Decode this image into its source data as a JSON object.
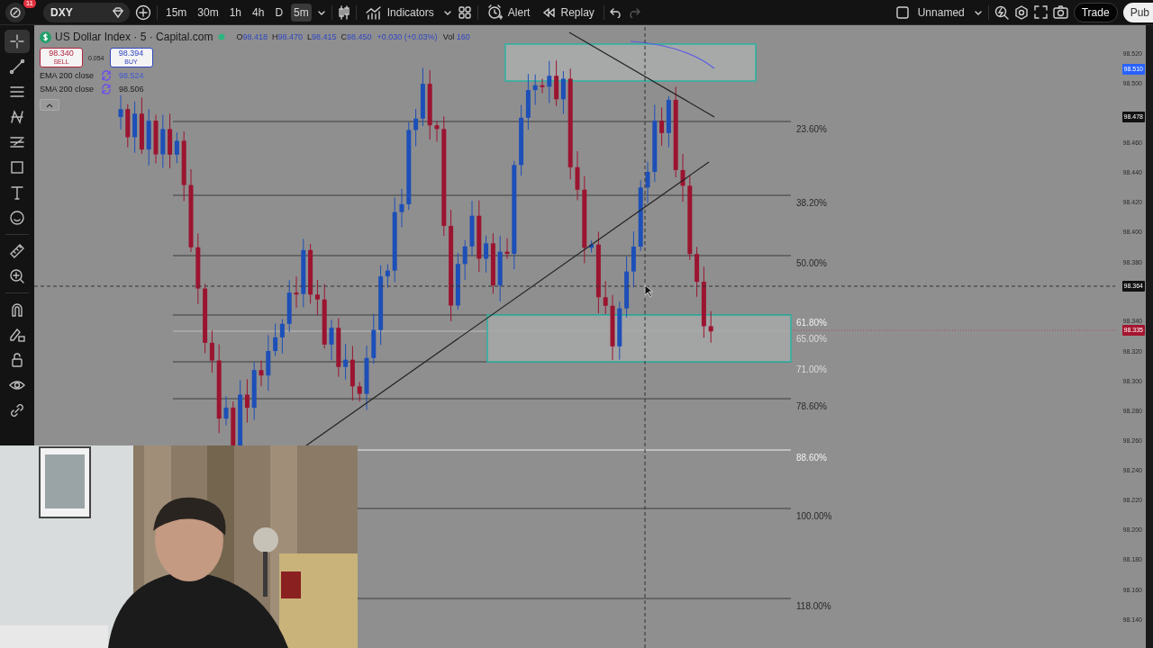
{
  "toolbar": {
    "notifications": "11",
    "symbol": "DXY",
    "intervals": [
      {
        "label": "15m",
        "selected": false
      },
      {
        "label": "30m",
        "selected": false
      },
      {
        "label": "1h",
        "selected": false
      },
      {
        "label": "4h",
        "selected": false
      },
      {
        "label": "D",
        "selected": false
      },
      {
        "label": "5m",
        "selected": true
      }
    ],
    "indicators": "Indicators",
    "alert": "Alert",
    "replay": "Replay",
    "layout_name": "Unnamed",
    "trade": "Trade",
    "publish": "Pub"
  },
  "drawing_tools": [
    {
      "kind": "crosshair",
      "selected": true
    },
    {
      "kind": "trendline",
      "selected": false
    },
    {
      "kind": "parallel",
      "selected": false
    },
    {
      "kind": "pattern",
      "selected": false
    },
    {
      "kind": "fib",
      "selected": false
    },
    {
      "kind": "rectangle",
      "selected": false
    },
    {
      "kind": "text",
      "selected": false
    },
    {
      "kind": "emoji",
      "selected": false
    },
    {
      "kind": "ruler",
      "selected": false
    },
    {
      "kind": "zoom",
      "selected": false
    },
    {
      "kind": "magnet",
      "selected": false
    },
    {
      "kind": "lockpen",
      "selected": false
    },
    {
      "kind": "lock",
      "selected": false
    },
    {
      "kind": "eye",
      "selected": false
    },
    {
      "kind": "link",
      "selected": false
    }
  ],
  "legend": {
    "title": "US Dollar Index · 5 · Capital.com",
    "ohlc": [
      {
        "key": "O",
        "value": "98.418"
      },
      {
        "key": "H",
        "value": "98.470"
      },
      {
        "key": "L",
        "value": "98.415"
      },
      {
        "key": "C",
        "value": "98.450"
      }
    ],
    "change": "+0.030 (+0.03%)",
    "volume_label": "Vol",
    "volume": "160",
    "sell": {
      "price": "98.340",
      "label": "SELL"
    },
    "spread": "0.054",
    "buy": {
      "price": "98.394",
      "label": "BUY"
    },
    "indicators": [
      {
        "name": "EMA 200 close",
        "value": "98.524",
        "color": "#4358d6"
      },
      {
        "name": "SMA 200 close",
        "value": "98.506",
        "color": "#222222"
      }
    ]
  },
  "fib_levels": [
    {
      "label": "23.60%",
      "color": "#2a2a2a"
    },
    {
      "label": "38.20%",
      "color": "#2a2a2a"
    },
    {
      "label": "50.00%",
      "color": "#2a2a2a"
    },
    {
      "label": "61.80%",
      "color": "#f2f2f2"
    },
    {
      "label": "65.00%",
      "color": "#dcdcdc"
    },
    {
      "label": "71.00%",
      "color": "#dcdcdc"
    },
    {
      "label": "78.60%",
      "color": "#2a2a2a"
    },
    {
      "label": "88.60%",
      "color": "#f2f2f2"
    },
    {
      "label": "100.00%",
      "color": "#2a2a2a"
    },
    {
      "label": "118.00%",
      "color": "#2a2a2a"
    }
  ],
  "price_axis": {
    "ticks": [
      "98.520",
      "98.500",
      "98.460",
      "98.440",
      "98.420",
      "98.400",
      "98.380",
      "98.340",
      "98.320",
      "98.300",
      "98.280",
      "98.260",
      "98.240",
      "98.220",
      "98.200",
      "98.180",
      "98.160",
      "98.140"
    ],
    "tags": [
      {
        "price": "98.510",
        "color": "#2962ff"
      },
      {
        "price": "98.478",
        "color": "#111111"
      },
      {
        "price": "98.364",
        "color": "#111111"
      },
      {
        "price": "98.335",
        "color": "#a5152f"
      }
    ]
  }
}
